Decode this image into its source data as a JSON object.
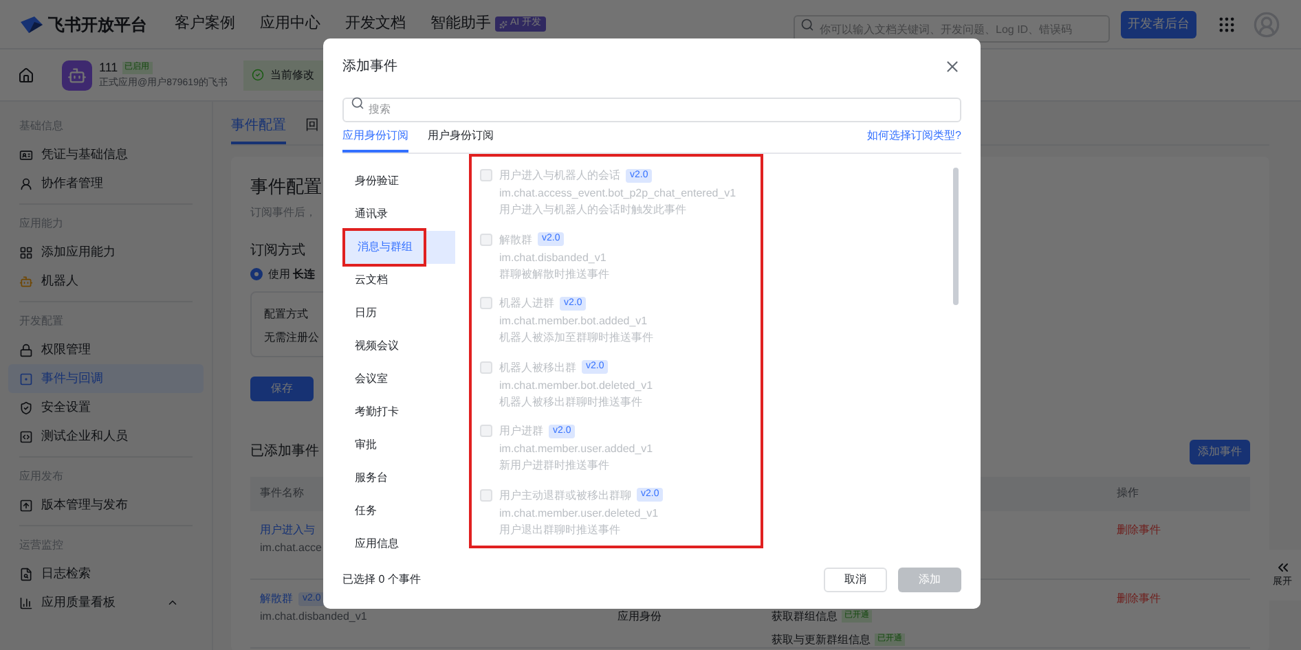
{
  "top_nav": {
    "logo": "飞书开放平台",
    "links": [
      "客户案例",
      "应用中心",
      "开发文档",
      "智能助手"
    ],
    "ai_badge": "AI 开发",
    "search": {
      "placeholder": "你可以输入文档关键词、开发问题、Log ID、错误码"
    },
    "console_button": "开发者后台"
  },
  "app_header": {
    "name": "111",
    "status": "已启用",
    "subtitle": "正式应用@用户879619的飞书",
    "notice": "当前修改"
  },
  "sidebar": {
    "sections": [
      {
        "title": "基础信息",
        "items": [
          {
            "label": "凭证与基础信息",
            "selected": false
          },
          {
            "label": "协作者管理",
            "selected": false
          }
        ]
      },
      {
        "title": "应用能力",
        "items": [
          {
            "label": "添加应用能力",
            "selected": false
          },
          {
            "label": "机器人",
            "selected": false
          }
        ]
      },
      {
        "title": "开发配置",
        "items": [
          {
            "label": "权限管理",
            "selected": false
          },
          {
            "label": "事件与回调",
            "selected": true
          },
          {
            "label": "安全设置",
            "selected": false
          },
          {
            "label": "测试企业和人员",
            "selected": false
          }
        ]
      },
      {
        "title": "应用发布",
        "items": [
          {
            "label": "版本管理与发布",
            "selected": false
          }
        ]
      },
      {
        "title": "运营监控",
        "items": [
          {
            "label": "日志检索",
            "selected": false
          },
          {
            "label": "应用质量看板",
            "selected": false
          }
        ]
      }
    ]
  },
  "content": {
    "tabs": [
      {
        "label": "事件配置",
        "selected": true
      },
      {
        "label": "回",
        "selected": false
      }
    ],
    "title": "事件配置",
    "description": "订阅事件后，",
    "subscription_title": "订阅方式",
    "radio": {
      "label": "使用 **长连**",
      "selected": true
    },
    "config_box": {
      "label": "配置方式",
      "value": "无需注册公"
    },
    "save_button": "保存",
    "added_title": "已添加事件",
    "add_button": "添加事件",
    "table": {
      "columns": [
        "事件名称",
        "操作"
      ],
      "rows": [
        {
          "name": "用户进入与",
          "code": "im.chat.acce",
          "action": "删除事件"
        },
        {
          "name": "解散群",
          "version": "v2.0",
          "code": "im.chat.disbanded_v1",
          "identity": "应用身份",
          "permissions": [
            {
              "label": "获取群组信息",
              "status": "已开通"
            },
            {
              "label": "获取与更新群组信息",
              "status": "已开通"
            }
          ],
          "action": "删除事件"
        }
      ]
    }
  },
  "expand_button": "展开",
  "dialog": {
    "title": "添加事件",
    "search": {
      "placeholder": "搜索"
    },
    "tabs": [
      {
        "label": "应用身份订阅",
        "selected": true
      },
      {
        "label": "用户身份订阅",
        "selected": false
      }
    ],
    "help_link": "如何选择订阅类型?",
    "categories": [
      {
        "label": "身份验证",
        "selected": false,
        "annotated": false
      },
      {
        "label": "通讯录",
        "selected": false,
        "annotated": false
      },
      {
        "label": "消息与群组",
        "selected": true,
        "annotated": true
      },
      {
        "label": "云文档",
        "selected": false,
        "annotated": false
      },
      {
        "label": "日历",
        "selected": false,
        "annotated": false
      },
      {
        "label": "视频会议",
        "selected": false,
        "annotated": false
      },
      {
        "label": "会议室",
        "selected": false,
        "annotated": false
      },
      {
        "label": "考勤打卡",
        "selected": false,
        "annotated": false
      },
      {
        "label": "审批",
        "selected": false,
        "annotated": false
      },
      {
        "label": "服务台",
        "selected": false,
        "annotated": false
      },
      {
        "label": "任务",
        "selected": false,
        "annotated": false
      },
      {
        "label": "应用信息",
        "selected": false,
        "annotated": false
      }
    ],
    "events_annotated": true,
    "events": [
      {
        "name": "用户进入与机器人的会话",
        "version": "v2.0",
        "code": "im.chat.access_event.bot_p2p_chat_entered_v1",
        "description": "用户进入与机器人的会话时触发此事件",
        "checked": false,
        "disabled": true
      },
      {
        "name": "解散群",
        "version": "v2.0",
        "code": "im.chat.disbanded_v1",
        "description": "群聊被解散时推送事件",
        "checked": false,
        "disabled": true
      },
      {
        "name": "机器人进群",
        "version": "v2.0",
        "code": "im.chat.member.bot.added_v1",
        "description": "机器人被添加至群聊时推送事件",
        "checked": false,
        "disabled": true
      },
      {
        "name": "机器人被移出群",
        "version": "v2.0",
        "code": "im.chat.member.bot.deleted_v1",
        "description": "机器人被移出群聊时推送事件",
        "checked": false,
        "disabled": true
      },
      {
        "name": "用户进群",
        "version": "v2.0",
        "code": "im.chat.member.user.added_v1",
        "description": "新用户进群时推送事件",
        "checked": false,
        "disabled": true
      },
      {
        "name": "用户主动退群或被移出群聊",
        "version": "v2.0",
        "code": "im.chat.member.user.deleted_v1",
        "description": "用户退出群聊时推送事件",
        "checked": false,
        "disabled": true
      }
    ],
    "selection_count": "已选择 0 个事件",
    "cancel_button": "取消",
    "add_button": {
      "label": "添加",
      "disabled": true
    }
  }
}
